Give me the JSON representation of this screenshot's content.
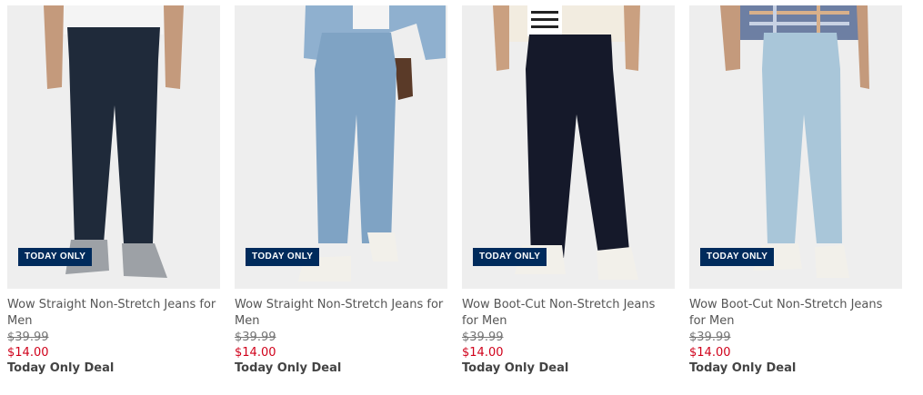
{
  "colors": {
    "badge_bg": "#002b5c",
    "sale_price": "#d0021b",
    "photo_bg": "#eeeeee"
  },
  "products": [
    {
      "badge": "TODAY ONLY",
      "title": "Wow Straight Non-Stretch Jeans for Men",
      "original_price": "$39.99",
      "sale_price": "$14.00",
      "deal_label": "Today Only Deal",
      "jeans_color": "#1f2a3a",
      "top_color": "#f4f4f4",
      "shoe_color": "#9da1a6"
    },
    {
      "badge": "TODAY ONLY",
      "title": "Wow Straight Non-Stretch Jeans for Men",
      "original_price": "$39.99",
      "sale_price": "$14.00",
      "deal_label": "Today Only Deal",
      "jeans_color": "#7fa3c4",
      "top_color": "#8fb0cf",
      "shoe_color": "#f2f0ea"
    },
    {
      "badge": "TODAY ONLY",
      "title": "Wow Boot-Cut Non-Stretch Jeans for Men",
      "original_price": "$39.99",
      "sale_price": "$14.00",
      "deal_label": "Today Only Deal",
      "jeans_color": "#15192a",
      "top_color": "#f2ece0",
      "shoe_color": "#f2f0ea"
    },
    {
      "badge": "TODAY ONLY",
      "title": "Wow Boot-Cut Non-Stretch Jeans for Men",
      "original_price": "$39.99",
      "sale_price": "$14.00",
      "deal_label": "Today Only Deal",
      "jeans_color": "#a9c6d9",
      "top_color": "#6d7fa3",
      "shoe_color": "#f2f0ea"
    }
  ]
}
